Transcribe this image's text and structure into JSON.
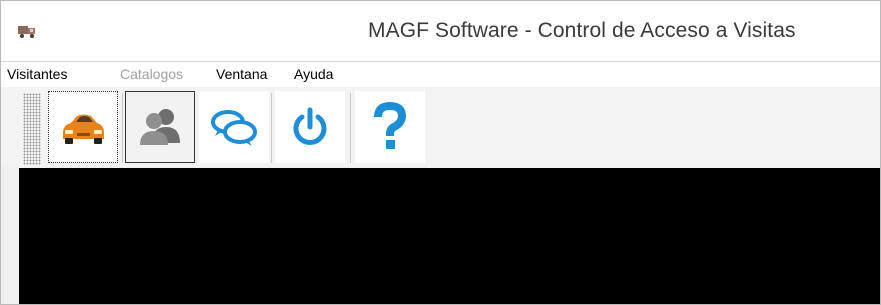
{
  "window": {
    "title": "MAGF Software - Control de Acceso a Visitas"
  },
  "menubar": {
    "items": [
      {
        "label": "Visitantes",
        "enabled": true
      },
      {
        "label": "Catalogos",
        "enabled": false
      },
      {
        "label": "Ventana",
        "enabled": true
      },
      {
        "label": "Ayuda",
        "enabled": true
      }
    ]
  },
  "toolbar": {
    "buttons": [
      {
        "icon": "car-icon",
        "state": "focused"
      },
      {
        "icon": "users-icon",
        "state": "pressed"
      },
      {
        "icon": "chat-bubbles-icon",
        "state": "normal"
      },
      {
        "icon": "power-icon",
        "state": "normal"
      },
      {
        "icon": "help-question-icon",
        "state": "normal"
      }
    ]
  },
  "colors": {
    "accent_blue": "#1e8fd6",
    "car_orange": "#e8821a",
    "desktop": "#000000"
  }
}
